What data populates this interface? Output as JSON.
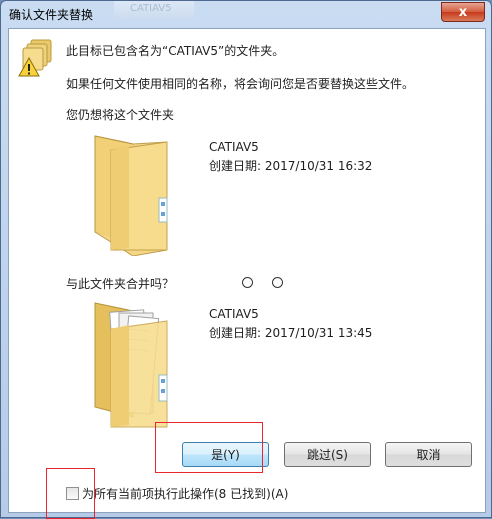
{
  "window": {
    "title": "确认文件夹替换",
    "ghost_tab_label": "CATIAV5",
    "close_label": "x"
  },
  "dialog": {
    "line1": "此目标已包含名为“CATIAV5”的文件夹。",
    "line2": "如果任何文件使用相同的名称，将会询问您是否要替换这些文件。",
    "line3": "您仍想将这个文件夹",
    "merge_question": "与此文件夹合并吗？"
  },
  "folder_target": {
    "name": "CATIAV5",
    "created": "创建日期: 2017/10/31 16:32"
  },
  "folder_source": {
    "name": "CATIAV5",
    "created": "创建日期: 2017/10/31 13:45"
  },
  "buttons": {
    "yes": "是(Y)",
    "skip": "跳过(S)",
    "cancel": "取消"
  },
  "checkbox": {
    "label": "为所有当前项执行此操作(8 已找到)(A)",
    "checked": false
  },
  "colors": {
    "highlight_box": "#e8262e",
    "folder_yellow": "#f3d27a"
  }
}
